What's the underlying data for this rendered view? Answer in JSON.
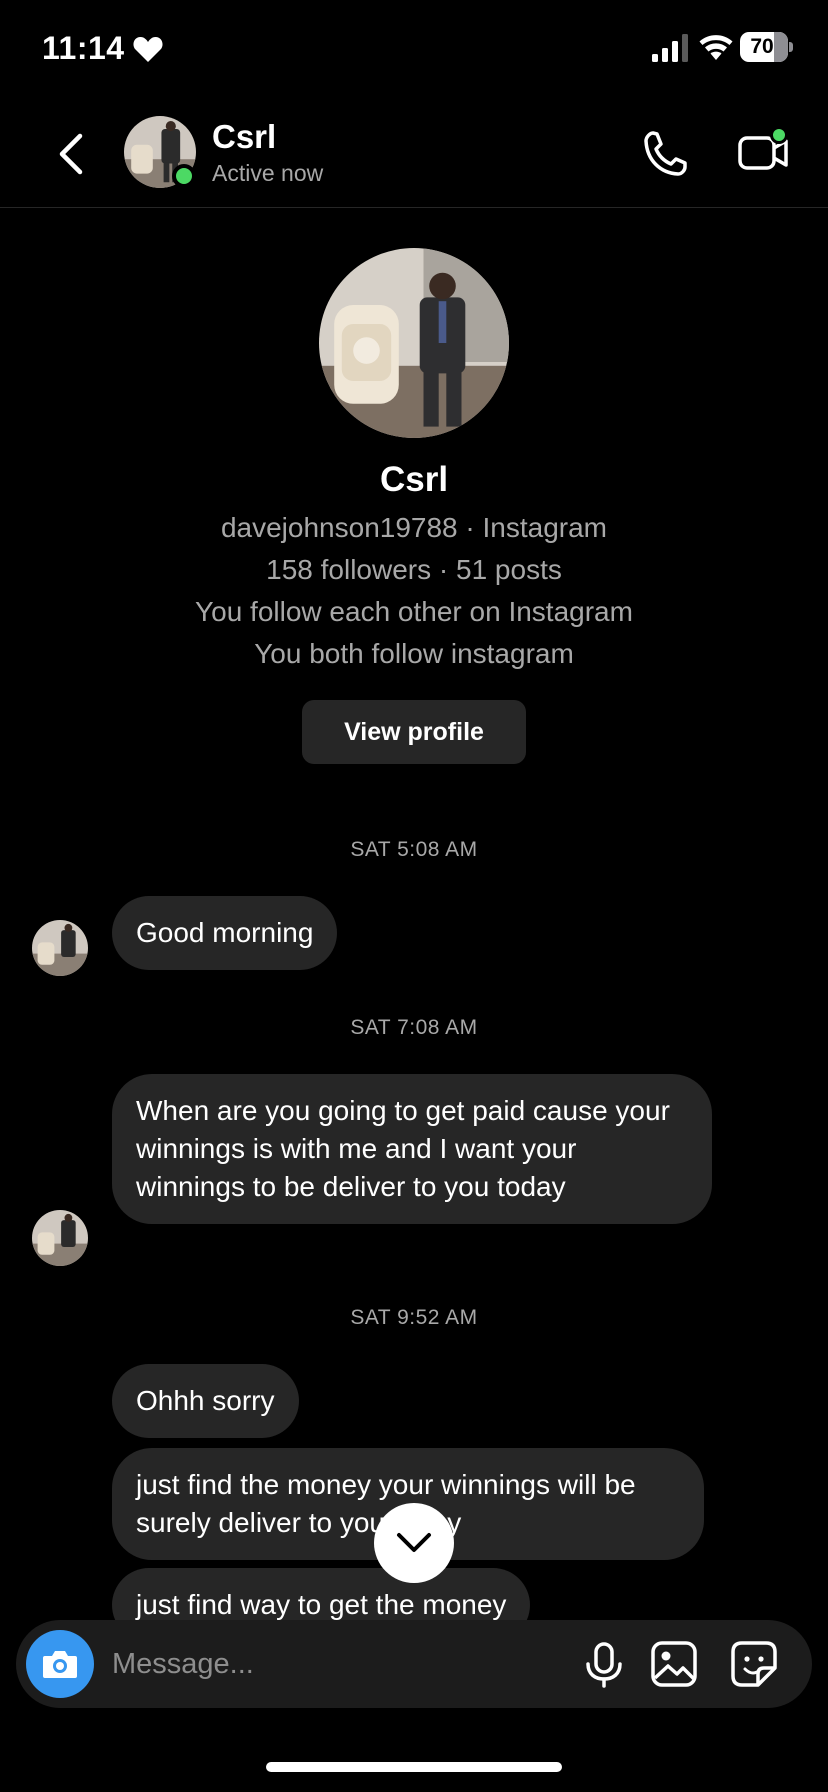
{
  "status_bar": {
    "time": "11:14",
    "battery": "70",
    "battery_level": 0.7,
    "icons": [
      "heart-icon",
      "signal-icon",
      "wifi-icon",
      "battery-icon"
    ]
  },
  "header": {
    "name": "Csrl",
    "status": "Active now",
    "icons": [
      "back-chevron-icon",
      "phone-icon",
      "video-camera-icon"
    ]
  },
  "profile": {
    "name": "Csrl",
    "handle_line": "davejohnson19788 · Instagram",
    "stats_line": "158 followers · 51 posts",
    "mutual_line": "You follow each other on Instagram",
    "common_line": "You both follow instagram",
    "view_profile_label": "View profile"
  },
  "conversation": {
    "ts1": "SAT 5:08 AM",
    "msg1": "Good morning",
    "ts2": "SAT 7:08 AM",
    "msg2": "When are you going to get paid  cause your winnings is with me and I want your winnings to be deliver to you today",
    "ts3": "SAT 9:52 AM",
    "msg3": "Ohhh sorry",
    "msg4": "just find the money your winnings will be surely deliver to you today",
    "msg5": "just find way to get the money"
  },
  "composer": {
    "placeholder": "Message...",
    "icons": [
      "camera-icon",
      "microphone-icon",
      "gallery-icon",
      "sticker-icon"
    ]
  },
  "colors": {
    "background": "#000000",
    "bubble": "#262626",
    "secondary_text": "#a8a8a8",
    "accent_blue": "#3797f0",
    "online_green": "#4cd964"
  }
}
